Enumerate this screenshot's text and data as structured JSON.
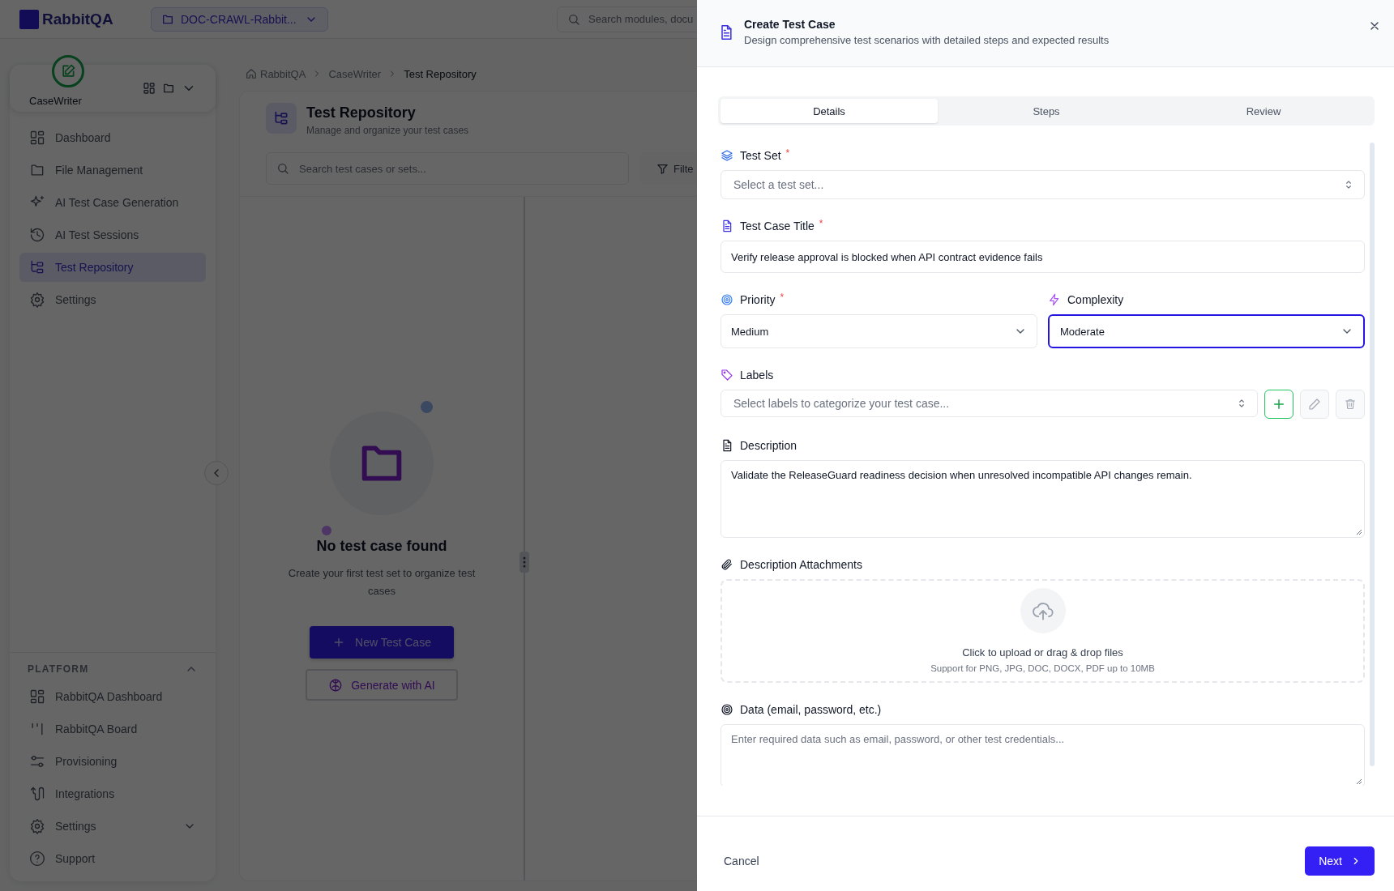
{
  "topbar": {
    "logo": "RabbitQA",
    "project": "DOC-CRAWL-Rabbit...",
    "search": {
      "placeholder": "Search modules, docu"
    }
  },
  "sidebar": {
    "module": "CaseWriter",
    "items": [
      {
        "label": "Dashboard",
        "selected": false
      },
      {
        "label": "File Management",
        "selected": false
      },
      {
        "label": "AI Test Case Generation",
        "selected": false
      },
      {
        "label": "AI Test Sessions",
        "selected": false
      },
      {
        "label": "Test Repository",
        "selected": true
      },
      {
        "label": "Settings",
        "selected": false
      }
    ],
    "platform": {
      "title": "PLATFORM",
      "expanded": true,
      "items": [
        {
          "label": "RabbitQA Dashboard",
          "kind": "link"
        },
        {
          "label": "RabbitQA Board",
          "kind": "link"
        },
        {
          "label": "Provisioning",
          "kind": "link"
        },
        {
          "label": "Integrations",
          "kind": "link"
        },
        {
          "label": "Settings",
          "kind": "group"
        },
        {
          "label": "Support",
          "kind": "link"
        }
      ]
    }
  },
  "breadcrumb": [
    "RabbitQA",
    "CaseWriter",
    "Test Repository"
  ],
  "repository": {
    "title": "Test Repository",
    "subtitle": "Manage and organize your test cases",
    "search": {
      "placeholder": "Search test cases or sets..."
    },
    "filter": "Filte",
    "empty": {
      "title": "No test case found",
      "text": "Create your first test set to organize test cases",
      "primary": "New Test Case",
      "secondary": "Generate with AI"
    }
  },
  "drawer": {
    "title": "Create Test Case",
    "subtitle": "Design comprehensive test scenarios with detailed steps and expected results",
    "tabs": [
      {
        "label": "Details",
        "selected": true
      },
      {
        "label": "Steps",
        "selected": false
      },
      {
        "label": "Review",
        "selected": false
      }
    ],
    "fields": [
      {
        "kind": "select",
        "label": "Test Set",
        "required_mark": "*",
        "placeholder": "Select a test set..."
      },
      {
        "kind": "input",
        "label": "Test Case Title",
        "required_mark": "*",
        "value": "Verify release approval is blocked when API contract evidence fails"
      },
      {
        "kind": "pair",
        "fields": [
          {
            "kind": "dropdown",
            "label": "Priority",
            "required_mark": "*",
            "value": "Medium",
            "focused": false
          },
          {
            "kind": "dropdown",
            "label": "Complexity",
            "value": "Moderate",
            "focused": true
          }
        ]
      },
      {
        "kind": "labels",
        "label": "Labels",
        "placeholder": "Select labels to categorize your test case..."
      },
      {
        "kind": "textarea",
        "label": "Description",
        "value": "Validate the ReleaseGuard readiness decision when unresolved incompatible API changes remain."
      },
      {
        "kind": "upload",
        "label": "Description Attachments",
        "prompt": "Click to upload or drag & drop files",
        "hint": "Support for PNG, JPG, DOC, DOCX, PDF up to 10MB"
      },
      {
        "kind": "textarea",
        "label": "Data (email, password, etc.)",
        "placeholder": "Enter required data such as email, password, or other test credentials..."
      }
    ],
    "cancel": "Cancel",
    "next": "Next"
  }
}
